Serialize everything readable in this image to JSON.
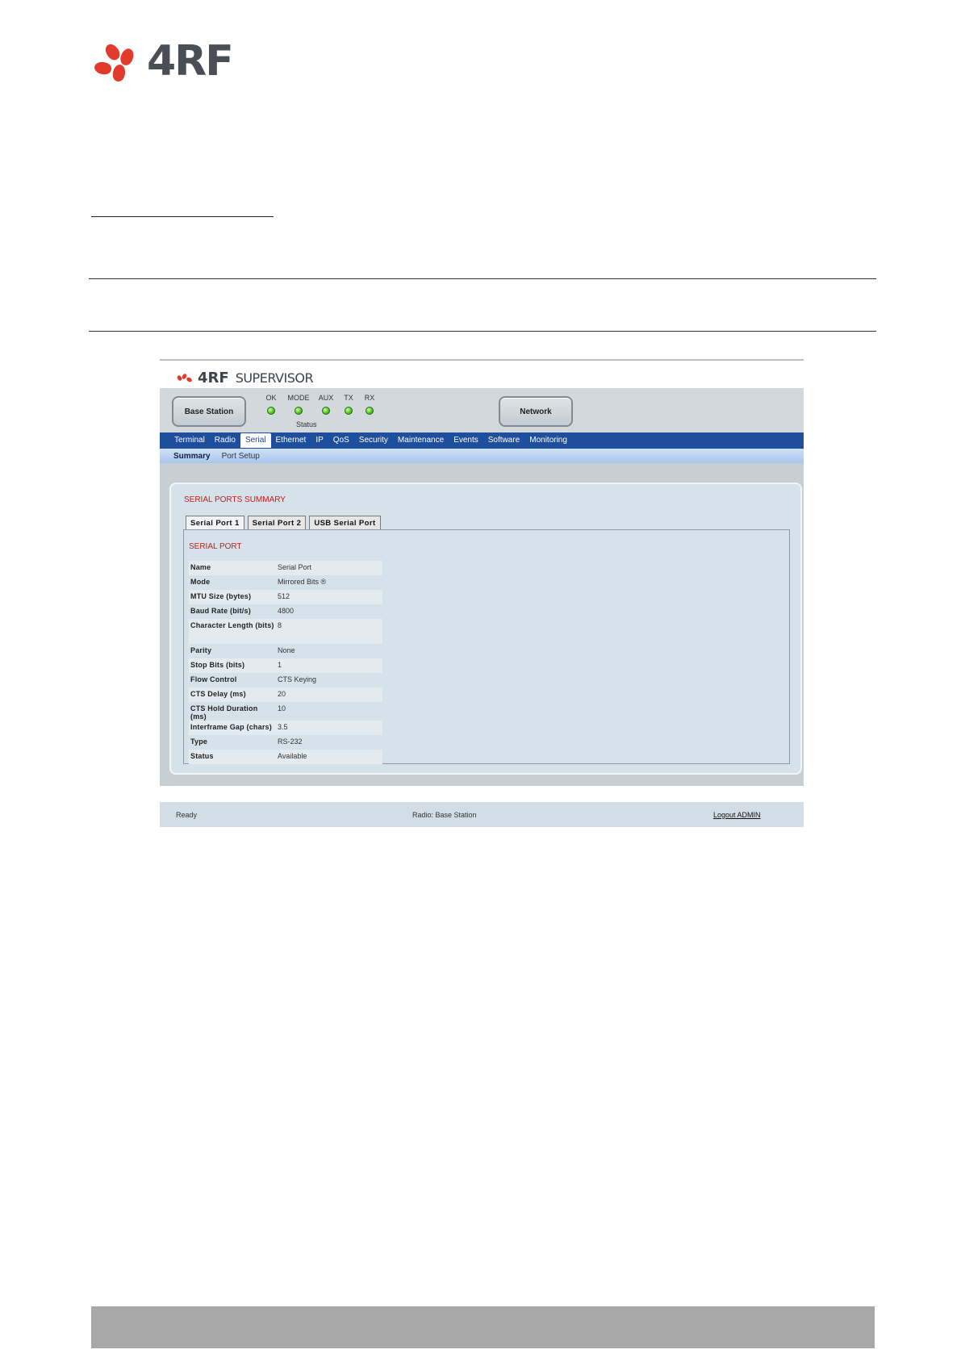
{
  "document": {
    "brand": "4RF"
  },
  "app": {
    "brand": "4RF",
    "product": "SUPERVISOR",
    "header": {
      "base_station_label": "Base Station",
      "network_label": "Network",
      "status_label": "Status",
      "leds": [
        {
          "label": "OK",
          "color": "#4fbf20"
        },
        {
          "label": "MODE",
          "color": "#4fbf20"
        },
        {
          "label": "AUX",
          "color": "#4fbf20"
        },
        {
          "label": "TX",
          "color": "#4fbf20"
        },
        {
          "label": "RX",
          "color": "#4fbf20"
        }
      ]
    },
    "tabs": [
      "Terminal",
      "Radio",
      "Serial",
      "Ethernet",
      "IP",
      "QoS",
      "Security",
      "Maintenance",
      "Events",
      "Software",
      "Monitoring"
    ],
    "active_tab": "Serial",
    "subtabs": [
      "Summary",
      "Port Setup"
    ],
    "active_subtab": "Summary",
    "panel": {
      "title": "SERIAL PORTS SUMMARY",
      "port_tabs": [
        "Serial Port 1",
        "Serial Port 2",
        "USB Serial Port"
      ],
      "active_port_tab": "Serial Port 1",
      "section_title": "SERIAL PORT",
      "rows": [
        {
          "key": "Name",
          "value": "Serial Port"
        },
        {
          "key": "Mode",
          "value": "Mirrored Bits ®"
        },
        {
          "key": "MTU Size (bytes)",
          "value": "512"
        },
        {
          "key": "Baud Rate (bit/s)",
          "value": "4800"
        },
        {
          "key": "Character Length (bits)",
          "value": "8"
        },
        {
          "key": "Parity",
          "value": "None"
        },
        {
          "key": "Stop Bits (bits)",
          "value": "1"
        },
        {
          "key": "Flow Control",
          "value": "CTS Keying"
        },
        {
          "key": "CTS Delay (ms)",
          "value": "20"
        },
        {
          "key": "CTS Hold Duration (ms)",
          "value": "10"
        },
        {
          "key": "Interframe Gap (chars)",
          "value": "3.5"
        },
        {
          "key": "Type",
          "value": "RS-232"
        },
        {
          "key": "Status",
          "value": "Available"
        }
      ]
    },
    "statusbar": {
      "ready": "Ready",
      "radio": "Radio: Base Station",
      "logout": "Logout ADMIN"
    },
    "colors": {
      "accent_red": "#c41a1a",
      "nav_blue": "#1f4e9c",
      "brand_red": "#e23b2e"
    }
  }
}
